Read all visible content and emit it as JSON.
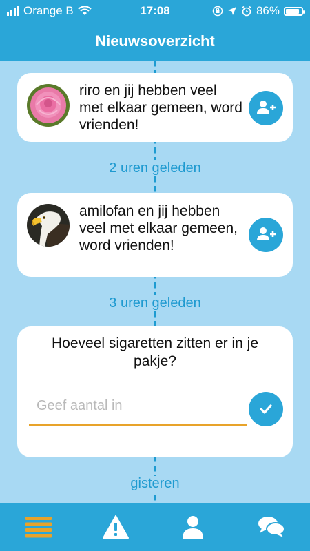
{
  "status_bar": {
    "carrier": "Orange B",
    "time": "17:08",
    "battery": "86%",
    "battery_level": 0.86
  },
  "header": {
    "title": "Nieuwsoverzicht"
  },
  "feed": [
    {
      "text": "riro en jij hebben veel met elkaar gemeen, word vrienden!",
      "avatar": "rose-photo"
    },
    {
      "time": "2 uren geleden"
    },
    {
      "text": "amilofan en jij hebben veel met elkaar gemeen, word vrienden!",
      "avatar": "eagle-photo"
    },
    {
      "time": "3 uren geleden"
    },
    {
      "question": "Hoeveel sigaretten zitten er in je pakje?",
      "placeholder": "Geef aantal in",
      "value": ""
    },
    {
      "time": "gisteren"
    }
  ],
  "tabs": [
    {
      "icon": "feed-icon",
      "active": true
    },
    {
      "icon": "warning-icon",
      "active": false
    },
    {
      "icon": "profile-icon",
      "active": false
    },
    {
      "icon": "chat-icon",
      "active": false
    }
  ],
  "colors": {
    "primary": "#2aa6d8",
    "background": "#a8d9f3",
    "active_tab": "#e8a32a",
    "input_underline": "#e8a32a"
  }
}
